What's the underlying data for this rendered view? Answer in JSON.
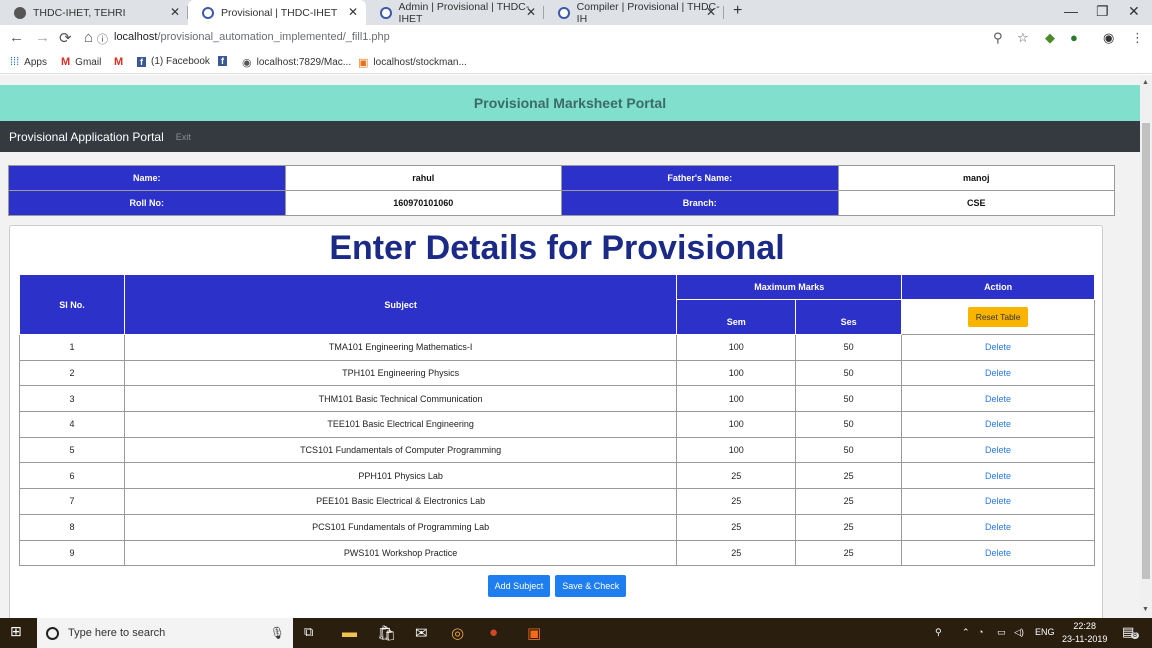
{
  "browser": {
    "tabs": [
      {
        "label": "THDC-IHET, TEHRI",
        "active": false
      },
      {
        "label": "Provisional | THDC-IHET",
        "active": true
      },
      {
        "label": "Admin | Provisional | THDC-IHET",
        "active": false
      },
      {
        "label": "Compiler | Provisional | THDC-IH",
        "active": false
      }
    ],
    "url_host": "localhost",
    "url_path": "/provisional_automation_implemented/_fill1.php",
    "bookmarks": [
      "Apps",
      "Gmail",
      "",
      "(1) Facebook",
      "",
      "localhost:7829/Mac...",
      "localhost/stockman..."
    ]
  },
  "page": {
    "banner_title": "Provisional Marksheet Portal",
    "navbar": {
      "brand": "Provisional Application Portal",
      "exit": "Exit"
    },
    "student": {
      "name_label": "Name:",
      "name": "rahul",
      "father_label": "Father's Name:",
      "father": "manoj",
      "roll_label": "Roll No:",
      "roll": "160970101060",
      "branch_label": "Branch:",
      "branch": "CSE"
    },
    "heading": "Enter Details for Provisional",
    "table": {
      "headers": {
        "sl": "Sl No.",
        "subject": "Subject",
        "max": "Maximum Marks",
        "action": "Action",
        "sem": "Sem",
        "ses": "Ses",
        "reset": "Reset Table"
      },
      "rows": [
        {
          "sl": "1",
          "subject": "TMA101 Engineering Mathematics-I",
          "sem": "100",
          "ses": "50",
          "action": "Delete"
        },
        {
          "sl": "2",
          "subject": "TPH101 Engineering Physics",
          "sem": "100",
          "ses": "50",
          "action": "Delete"
        },
        {
          "sl": "3",
          "subject": "THM101 Basic Technical Communication",
          "sem": "100",
          "ses": "50",
          "action": "Delete"
        },
        {
          "sl": "4",
          "subject": "TEE101 Basic Electrical Engineering",
          "sem": "100",
          "ses": "50",
          "action": "Delete"
        },
        {
          "sl": "5",
          "subject": "TCS101 Fundamentals of Computer Programming",
          "sem": "100",
          "ses": "50",
          "action": "Delete"
        },
        {
          "sl": "6",
          "subject": "PPH101 Physics Lab",
          "sem": "25",
          "ses": "25",
          "action": "Delete"
        },
        {
          "sl": "7",
          "subject": "PEE101 Basic Electrical & Electronics Lab",
          "sem": "25",
          "ses": "25",
          "action": "Delete"
        },
        {
          "sl": "8",
          "subject": "PCS101 Fundamentals of Programming Lab",
          "sem": "25",
          "ses": "25",
          "action": "Delete"
        },
        {
          "sl": "9",
          "subject": "PWS101 Workshop Practice",
          "sem": "25",
          "ses": "25",
          "action": "Delete"
        }
      ]
    },
    "buttons": {
      "add_subject": "Add Subject",
      "save_check": "Save & Check"
    }
  },
  "taskbar": {
    "search_placeholder": "Type here to search",
    "language": "ENG",
    "time": "22:28",
    "date": "23-11-2019",
    "notifications": "8"
  },
  "colors": {
    "banner": "#80dfcd",
    "navbar": "#343a40",
    "table_header": "#2c31c9",
    "heading": "#1b2a86",
    "reset_button": "#f9b400",
    "primary_button": "#1e7ef0",
    "delete_link": "#2a7ae4"
  }
}
